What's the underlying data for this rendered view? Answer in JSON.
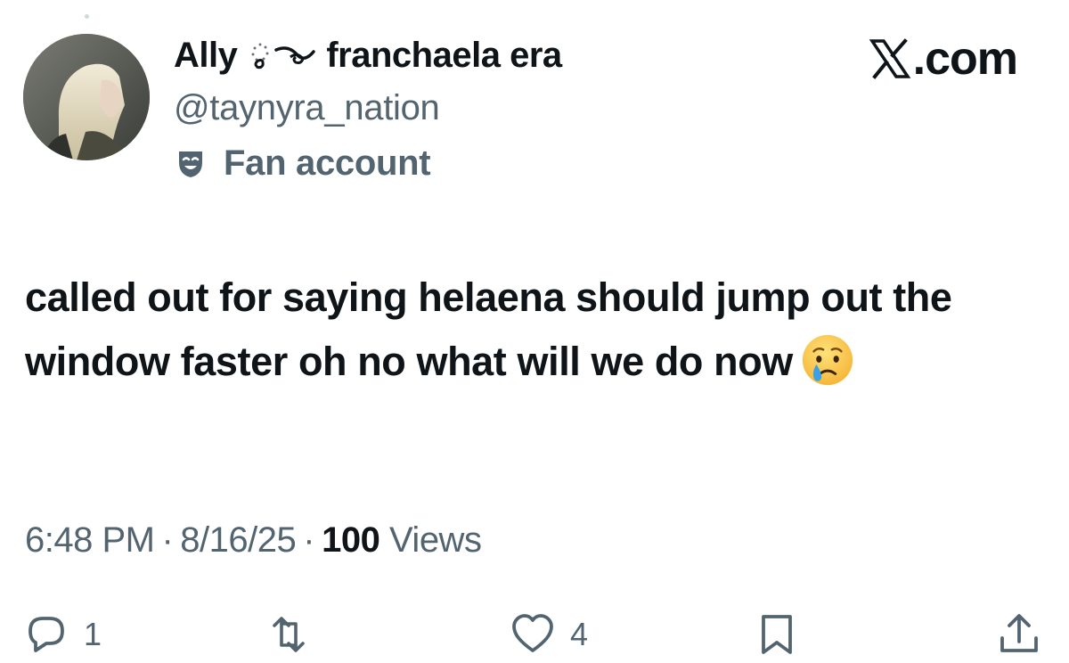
{
  "user": {
    "display_name": "Ally",
    "name_suffix": "franchaela era",
    "handle": "@taynyra_nation",
    "label": "Fan account",
    "avatar_icon": "avatar-image"
  },
  "brand": {
    "text": ".com",
    "logo_icon": "x-logo-icon"
  },
  "tweet": {
    "text": "called out for saying helaena should jump out the window faster oh no what will we do now",
    "emoji": "crying-face-emoji"
  },
  "meta": {
    "time": "6:48 PM",
    "date": "8/16/25",
    "views_count": "100",
    "views_label": "Views",
    "separator": "·"
  },
  "actions": {
    "reply_count": "1",
    "like_count": "4"
  },
  "colors": {
    "text": "#0f1419",
    "secondary": "#536471",
    "background": "#ffffff"
  }
}
